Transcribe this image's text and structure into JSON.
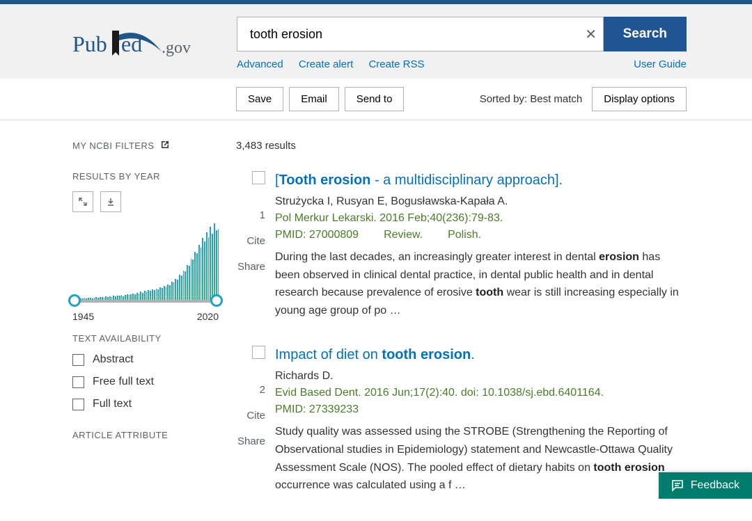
{
  "header": {
    "search_value": "tooth erosion",
    "search_button": "Search",
    "links": {
      "advanced": "Advanced",
      "create_alert": "Create alert",
      "create_rss": "Create RSS",
      "user_guide": "User Guide"
    }
  },
  "toolbar": {
    "save": "Save",
    "email": "Email",
    "send_to": "Send to",
    "sorted_by": "Sorted by: Best match",
    "display_options": "Display options"
  },
  "sidebar": {
    "my_filters": "MY NCBI FILTERS",
    "results_by_year": "RESULTS BY YEAR",
    "year_start": "1945",
    "year_end": "2020",
    "text_availability": "TEXT AVAILABILITY",
    "text_opts": [
      "Abstract",
      "Free full text",
      "Full text"
    ],
    "article_attribute": "ARTICLE ATTRIBUTE"
  },
  "results_count": "3,483 results",
  "results": [
    {
      "index": "1",
      "title_html": "[<b>Tooth erosion</b> - a multidisciplinary approach].",
      "authors": "Strużycka I, Rusyan E, Bogusławska-Kapała A.",
      "cite": "Pol Merkur Lekarski. 2016 Feb;40(236):79-83.",
      "pmid": "PMID: 27000809",
      "type": "Review.",
      "lang": "Polish.",
      "snippet_html": "During the last decades, an increasingly greater interest in dental <b>erosion</b> has been observed in clinical dental practice, in dental public health and in dental research because prevalence of erosive <b>tooth</b> wear is still increasing especially in young age group of po …"
    },
    {
      "index": "2",
      "title_html": "Impact of diet on <b>tooth erosion</b>.",
      "authors": "Richards D.",
      "cite": "Evid Based Dent. 2016 Jun;17(2):40. doi: 10.1038/sj.ebd.6401164.",
      "pmid": "PMID: 27339233",
      "type": "",
      "lang": "",
      "snippet_html": "Study quality was assessed using the STROBE (Strengthening the Reporting of Observational studies in Epidemiology) statement and Newcastle-Ottawa Quality Assessment Scale (NOS). The pooled effect of dietary habits on <b>tooth erosion</b> occurrence was calculated using a f …"
    }
  ],
  "actions": {
    "cite": "Cite",
    "share": "Share"
  },
  "feedback": "Feedback",
  "chart": {
    "year_start": 1945,
    "year_end": 2020,
    "bars": [
      2,
      2,
      2,
      3,
      2,
      2,
      3,
      2,
      3,
      3,
      2,
      3,
      4,
      3,
      4,
      4,
      3,
      5,
      4,
      5,
      4,
      6,
      5,
      6,
      6,
      7,
      5,
      7,
      8,
      7,
      8,
      9,
      8,
      10,
      9,
      11,
      10,
      12,
      11,
      13,
      12,
      14,
      13,
      15,
      14,
      17,
      16,
      19,
      18,
      21,
      20,
      25,
      24,
      29,
      28,
      34,
      33,
      40,
      39,
      48,
      47,
      56,
      55,
      66,
      64,
      75,
      72,
      85,
      80,
      93,
      86,
      100,
      91,
      105,
      95,
      97
    ]
  }
}
